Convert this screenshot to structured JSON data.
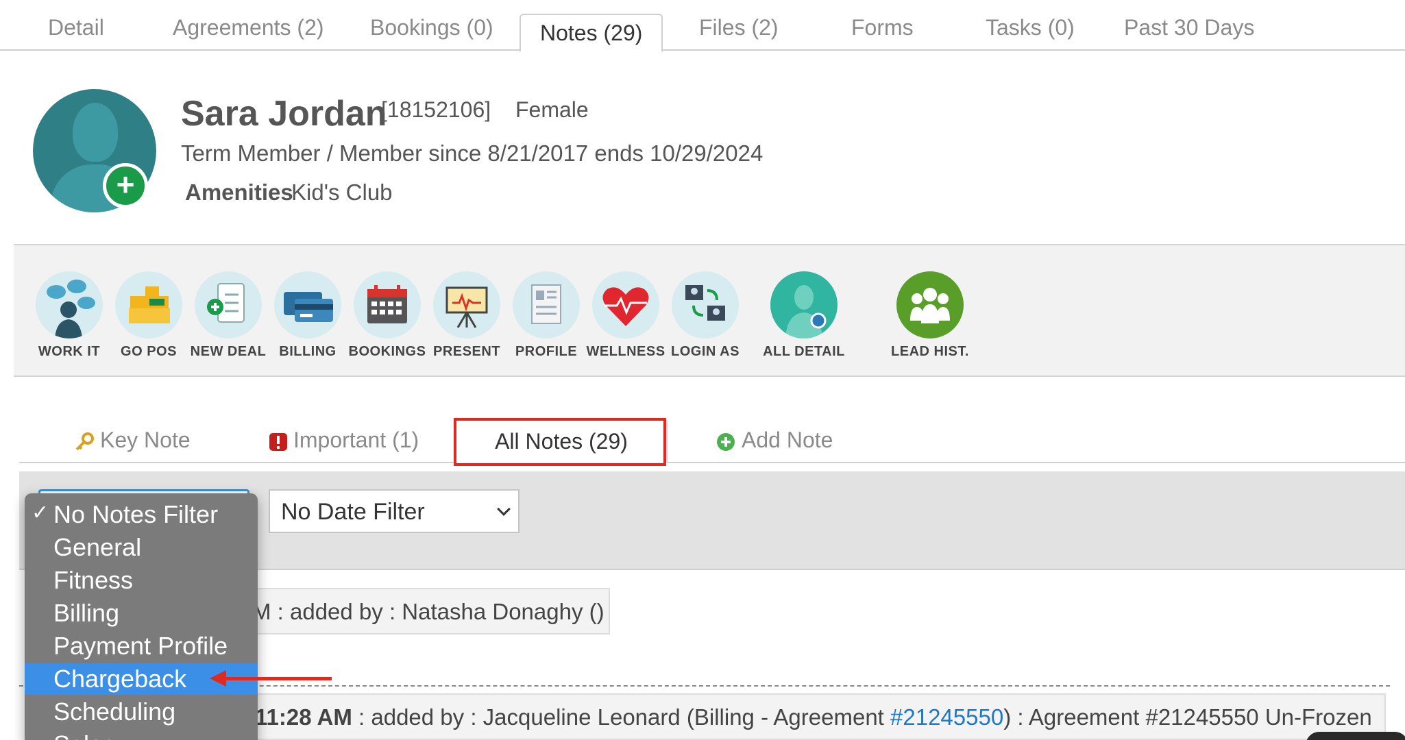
{
  "top_tabs": [
    {
      "label": "Detail"
    },
    {
      "label": "Agreements (2)"
    },
    {
      "label": "Bookings (0)"
    },
    {
      "label": "Notes (29)"
    },
    {
      "label": "Files (2)"
    },
    {
      "label": "Forms"
    },
    {
      "label": "Tasks (0)"
    },
    {
      "label": "Past 30 Days"
    }
  ],
  "member": {
    "name": "Sara Jordan",
    "id": "[18152106]",
    "gender": "Female",
    "status": "Term Member / Member since 8/21/2017 ends 10/29/2024",
    "amenities_label": "Amenities",
    "amenities_value": "Kid's Club"
  },
  "toolbar": [
    {
      "label": "WORK IT",
      "icon": "chat-person-icon"
    },
    {
      "label": "GO POS",
      "icon": "cash-register-icon"
    },
    {
      "label": "NEW DEAL",
      "icon": "clipboard-add-icon"
    },
    {
      "label": "BILLING",
      "icon": "credit-card-icon"
    },
    {
      "label": "BOOKINGS",
      "icon": "calendar-icon"
    },
    {
      "label": "PRESENT",
      "icon": "presentation-board-icon"
    },
    {
      "label": "PROFILE",
      "icon": "profile-document-icon"
    },
    {
      "label": "WELLNESS",
      "icon": "heart-pulse-icon"
    },
    {
      "label": "LOGIN AS",
      "icon": "switch-user-icon"
    },
    {
      "label": "ALL DETAIL",
      "icon": "person-detail-icon"
    },
    {
      "label": "LEAD HIST.",
      "icon": "group-icon"
    }
  ],
  "notes_tabs": {
    "key_note": "Key Note",
    "important": "Important (1)",
    "all_notes": "All Notes (29)",
    "add_note": "Add Note"
  },
  "filters": {
    "date_filter": "No Date Filter"
  },
  "notes_filter_menu": {
    "options": [
      "No Notes Filter",
      "General",
      "Fitness",
      "Billing",
      "Payment Profile",
      "Chargeback",
      "Scheduling",
      "Sales"
    ],
    "checked": "No Notes Filter",
    "highlighted": "Chargeback"
  },
  "notes": [
    {
      "text": "M : added by : Natasha Donaghy () :"
    },
    {
      "time": "11:28 AM",
      "prefix": " : added by : Jacqueline Leonard (Billing - Agreement ",
      "link": "#21245550",
      "suffix": ") : Agreement #21245550 Un-Frozen"
    }
  ],
  "colors": {
    "accent_blue": "#3b8fe6",
    "annotation_red": "#e02a20",
    "avatar_teal": "#2f7f86",
    "add_green": "#1a9b4a"
  }
}
